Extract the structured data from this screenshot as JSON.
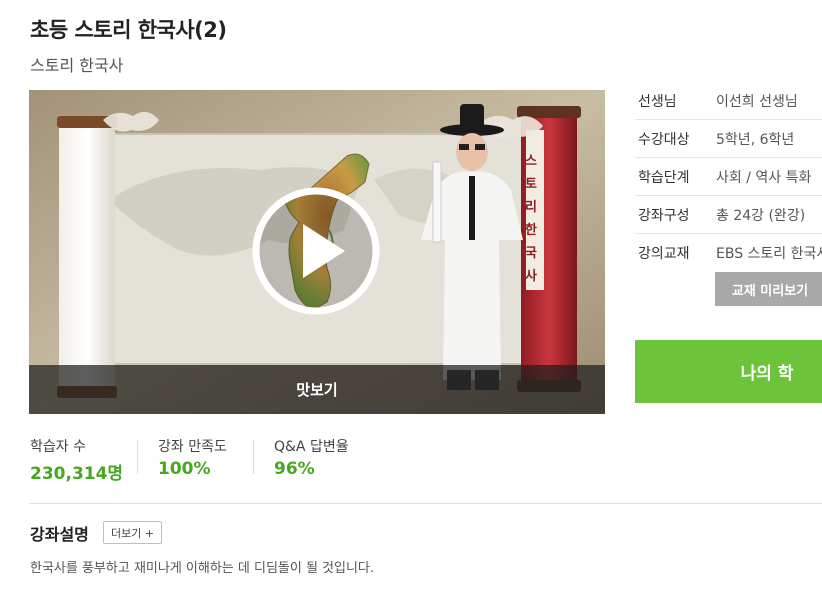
{
  "page": {
    "title": "초등 스토리 한국사(2)",
    "subtitle": "스토리 한국사"
  },
  "video": {
    "preview_label": "맛보기",
    "scroll_text": [
      "스",
      "토",
      "리",
      "한",
      "국",
      "사"
    ]
  },
  "info": {
    "rows": [
      {
        "key": "선생님",
        "value": "이선희 선생님"
      },
      {
        "key": "수강대상",
        "value": "5학년, 6학년"
      },
      {
        "key": "학습단계",
        "value": "사회 / 역사 특화"
      },
      {
        "key": "강좌구성",
        "value": "총 24강 (완강)"
      },
      {
        "key": "강의교재",
        "value": "EBS 스토리 한국사"
      }
    ],
    "textbook_preview_button": "교재 미리보기",
    "my_study_button": "나의 학"
  },
  "stats": [
    {
      "label": "학습자 수",
      "value": "230,314명"
    },
    {
      "label": "강좌 만족도",
      "value": "100%"
    },
    {
      "label": "Q&A 답변율",
      "value": "96%"
    }
  ],
  "description": {
    "title": "강좌설명",
    "more_button": "더보기 +",
    "text": "한국사를 풍부하고 재미나게 이해하는 데 디딤돌이 될 것입니다."
  },
  "colors": {
    "accent_green": "#6dc43a",
    "stat_green": "#45a81f",
    "grey_button": "#a8a8a8"
  }
}
